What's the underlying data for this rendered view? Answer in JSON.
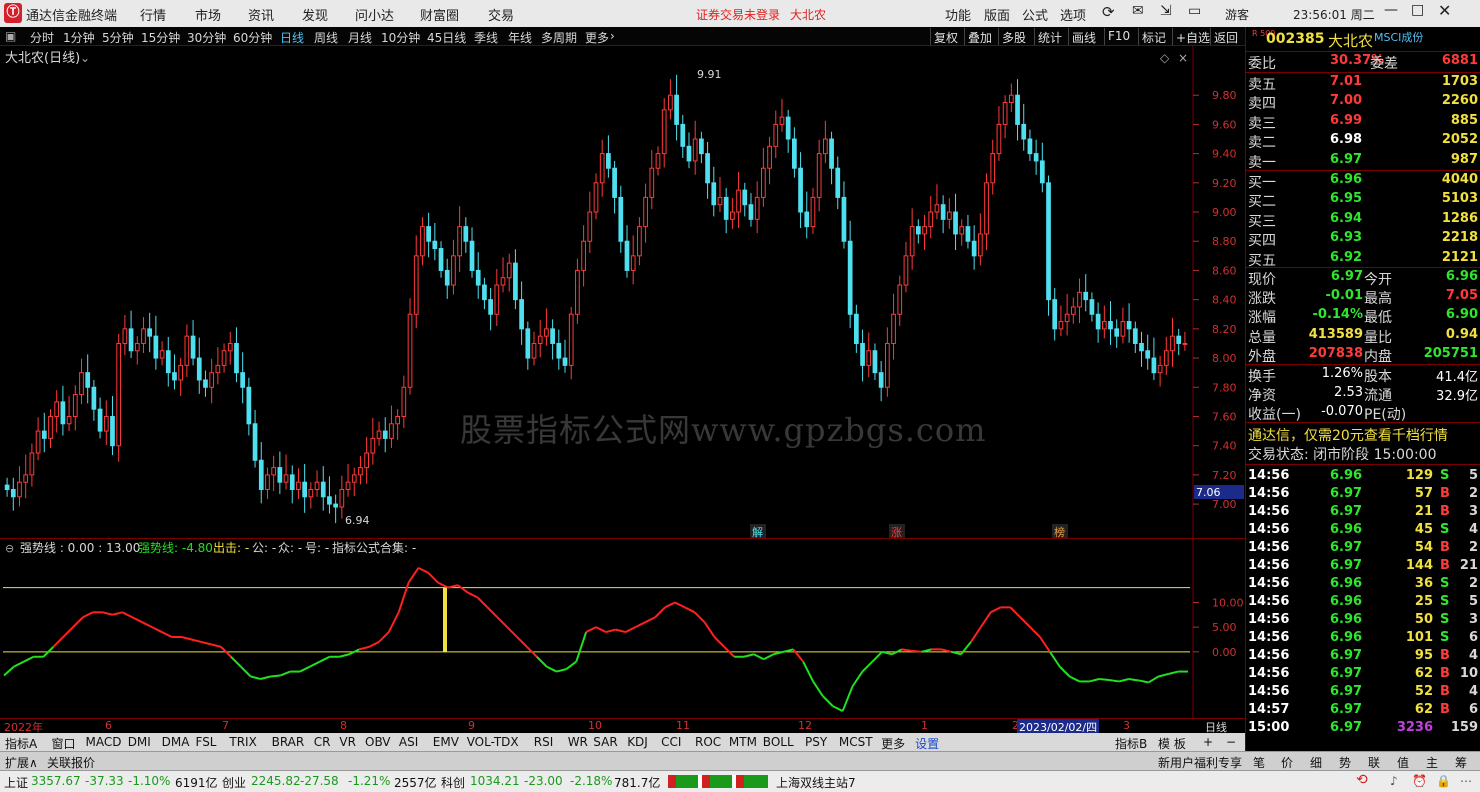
{
  "titlebar": {
    "app_name": "通达信金融终端",
    "menus": [
      "行情",
      "市场",
      "资讯",
      "发现",
      "问小达",
      "财富圈",
      "交易"
    ],
    "notice": "证券交易未登录",
    "stock_name": "大北农",
    "right_menus": [
      "功能",
      "版面",
      "公式",
      "选项"
    ],
    "user": "游客",
    "clock": "23:56:01 周二"
  },
  "periods": [
    "分时",
    "1分钟",
    "5分钟",
    "15分钟",
    "30分钟",
    "60分钟",
    "日线",
    "周线",
    "月线",
    "10分钟",
    "45日线",
    "季线",
    "年线",
    "多周期",
    "更多"
  ],
  "active_period": "日线",
  "chart_tools": [
    "复权",
    "叠加",
    "多股",
    "统计",
    "画线",
    "F10",
    "标记",
    "+自选",
    "返回"
  ],
  "chart_title": "大北农(日线)",
  "price_axis": [
    "9.80",
    "9.60",
    "9.40",
    "9.20",
    "9.00",
    "8.80",
    "8.60",
    "8.40",
    "8.20",
    "8.00",
    "7.80",
    "7.60",
    "7.40",
    "7.20",
    "7.00"
  ],
  "current_price_tag": "7.06",
  "chart_annotations": {
    "high": "9.91",
    "low": "6.94"
  },
  "event_marks": [
    "解",
    "涨",
    "榜"
  ],
  "indicator_header": {
    "name": "强势线 : 0.00 : 13.00",
    "line": "强势线: -4.80",
    "out": "出击: -",
    "gong": "公: -",
    "zhong": "众: -",
    "hao": "号: -",
    "collection": "指标公式合集: -"
  },
  "indicator_axis": [
    "10.00",
    "5.00",
    "0.00"
  ],
  "watermark": "股票指标公式网www.gpzbgs.com",
  "date_axis": {
    "labels": [
      "2022年",
      "6",
      "7",
      "8",
      "9",
      "10",
      "11",
      "12",
      "1",
      "2",
      "3"
    ],
    "cursor_date": "2023/02/02/四",
    "period_label": "日线"
  },
  "indicator_tabs": [
    "指标A",
    "窗口",
    "MACD",
    "DMI",
    "DMA",
    "FSL",
    "TRIX",
    "BRAR",
    "CR",
    "VR",
    "OBV",
    "ASI",
    "EMV",
    "VOL-TDX",
    "RSI",
    "WR",
    "SAR",
    "KDJ",
    "CCI",
    "ROC",
    "MTM",
    "BOLL",
    "PSY",
    "MCST",
    "更多",
    "设置"
  ],
  "indicator_tabs_right": [
    "指标B",
    "模 板",
    "+",
    "−"
  ],
  "ext_tabs": [
    "扩展∧",
    "关联报价"
  ],
  "ext_right": {
    "promo": "新用户福利专享",
    "tabs": [
      "笔",
      "价",
      "细",
      "势",
      "联",
      "值",
      "主",
      "筹"
    ]
  },
  "status": {
    "sh_label": "上证",
    "sh_value": "3357.67",
    "sh_change": "-37.33",
    "sh_pct": "-1.10%",
    "sh_amount": "6191亿",
    "cy_label": "创业",
    "cy_value": "2245.82",
    "cy_change": "-27.58",
    "cy_pct": "-1.21%",
    "cy_amount": "2557亿",
    "kc_label": "科创",
    "kc_value": "1034.21",
    "kc_change": "-23.00",
    "kc_pct": "-2.18%",
    "kc_amount": "781.7亿",
    "server": "上海双线主站7"
  },
  "quote": {
    "badge": "R 500",
    "code": "002385",
    "name": "大北农",
    "tag": "MSCI成份",
    "wb_label": "委比",
    "wb_value": "30.37%",
    "wc_label": "委差",
    "wc_value": "6881",
    "asks": [
      {
        "label": "卖五",
        "price": "7.01",
        "vol": "1703",
        "color": "#ff3a3a"
      },
      {
        "label": "卖四",
        "price": "7.00",
        "vol": "2260",
        "color": "#ff3a3a"
      },
      {
        "label": "卖三",
        "price": "6.99",
        "vol": "885",
        "color": "#ff3a3a"
      },
      {
        "label": "卖二",
        "price": "6.98",
        "vol": "2052",
        "color": "#ffffff"
      },
      {
        "label": "卖一",
        "price": "6.97",
        "vol": "987",
        "color": "#2ee62e"
      }
    ],
    "bids": [
      {
        "label": "买一",
        "price": "6.96",
        "vol": "4040",
        "color": "#2ee62e"
      },
      {
        "label": "买二",
        "price": "6.95",
        "vol": "5103",
        "color": "#2ee62e"
      },
      {
        "label": "买三",
        "price": "6.94",
        "vol": "1286",
        "color": "#2ee62e"
      },
      {
        "label": "买四",
        "price": "6.93",
        "vol": "2218",
        "color": "#2ee62e"
      },
      {
        "label": "买五",
        "price": "6.92",
        "vol": "2121",
        "color": "#2ee62e"
      }
    ],
    "stats": [
      {
        "l1": "现价",
        "v1": "6.97",
        "c1": "#2ee62e",
        "l2": "今开",
        "v2": "6.96",
        "c2": "#2ee62e"
      },
      {
        "l1": "涨跌",
        "v1": "-0.01",
        "c1": "#2ee62e",
        "l2": "最高",
        "v2": "7.05",
        "c2": "#ff3a3a"
      },
      {
        "l1": "涨幅",
        "v1": "-0.14%",
        "c1": "#2ee62e",
        "l2": "最低",
        "v2": "6.90",
        "c2": "#2ee62e"
      },
      {
        "l1": "总量",
        "v1": "413589",
        "c1": "#f0e040",
        "l2": "量比",
        "v2": "0.94",
        "c2": "#f0e040"
      },
      {
        "l1": "外盘",
        "v1": "207838",
        "c1": "#ff3a3a",
        "l2": "内盘",
        "v2": "205751",
        "c2": "#2ee62e"
      }
    ],
    "stats2": [
      {
        "l1": "换手",
        "v1": "1.26%",
        "l2": "股本",
        "v2": "41.4亿"
      },
      {
        "l1": "净资",
        "v1": "2.53",
        "l2": "流通",
        "v2": "32.9亿"
      },
      {
        "l1": "收益(一)",
        "v1": "-0.070",
        "l2": "PE(动)",
        "v2": ""
      }
    ],
    "promo": "通达信，仅需20元查看千档行情",
    "trade_state": "交易状态: 闭市阶段 15:00:00",
    "ticks": [
      {
        "t": "14:56",
        "p": "6.96",
        "pc": "#2ee62e",
        "v": "129",
        "d": "S",
        "n": "5"
      },
      {
        "t": "14:56",
        "p": "6.97",
        "pc": "#2ee62e",
        "v": "57",
        "d": "B",
        "n": "2"
      },
      {
        "t": "14:56",
        "p": "6.97",
        "pc": "#2ee62e",
        "v": "21",
        "d": "B",
        "n": "3"
      },
      {
        "t": "14:56",
        "p": "6.96",
        "pc": "#2ee62e",
        "v": "45",
        "d": "S",
        "n": "4"
      },
      {
        "t": "14:56",
        "p": "6.97",
        "pc": "#2ee62e",
        "v": "54",
        "d": "B",
        "n": "2"
      },
      {
        "t": "14:56",
        "p": "6.97",
        "pc": "#2ee62e",
        "v": "144",
        "d": "B",
        "n": "21"
      },
      {
        "t": "14:56",
        "p": "6.96",
        "pc": "#2ee62e",
        "v": "36",
        "d": "S",
        "n": "2"
      },
      {
        "t": "14:56",
        "p": "6.96",
        "pc": "#2ee62e",
        "v": "25",
        "d": "S",
        "n": "5"
      },
      {
        "t": "14:56",
        "p": "6.96",
        "pc": "#2ee62e",
        "v": "50",
        "d": "S",
        "n": "3"
      },
      {
        "t": "14:56",
        "p": "6.96",
        "pc": "#2ee62e",
        "v": "101",
        "d": "S",
        "n": "6"
      },
      {
        "t": "14:56",
        "p": "6.97",
        "pc": "#2ee62e",
        "v": "95",
        "d": "B",
        "n": "4"
      },
      {
        "t": "14:56",
        "p": "6.97",
        "pc": "#2ee62e",
        "v": "62",
        "d": "B",
        "n": "10"
      },
      {
        "t": "14:56",
        "p": "6.97",
        "pc": "#2ee62e",
        "v": "52",
        "d": "B",
        "n": "4"
      },
      {
        "t": "14:57",
        "p": "6.97",
        "pc": "#2ee62e",
        "v": "62",
        "d": "B",
        "n": "6"
      },
      {
        "t": "15:00",
        "p": "6.97",
        "pc": "#2ee62e",
        "v": "3236",
        "d": "",
        "n": "159"
      }
    ]
  },
  "colors": {
    "up": "#ff3a3a",
    "down": "#4fe0f0",
    "red_line": "#ff2020",
    "green_line": "#20e020",
    "yellow": "#f0e040",
    "bg": "#000000"
  },
  "chart_data": {
    "type": "candlestick",
    "ylim": [
      6.85,
      10.0
    ],
    "closes": [
      7.1,
      7.05,
      7.15,
      7.2,
      7.35,
      7.5,
      7.45,
      7.6,
      7.7,
      7.55,
      7.6,
      7.75,
      7.9,
      7.8,
      7.65,
      7.5,
      7.6,
      7.4,
      8.1,
      8.2,
      8.05,
      8.1,
      8.2,
      8.15,
      8.0,
      8.05,
      7.9,
      7.85,
      7.95,
      8.15,
      8.0,
      7.85,
      7.8,
      7.9,
      7.95,
      8.05,
      8.1,
      7.9,
      7.8,
      7.55,
      7.3,
      7.1,
      7.2,
      7.25,
      7.15,
      7.2,
      7.1,
      7.15,
      7.05,
      7.1,
      7.15,
      7.05,
      7.0,
      6.98,
      7.1,
      7.15,
      7.2,
      7.25,
      7.35,
      7.45,
      7.5,
      7.45,
      7.55,
      7.6,
      7.8,
      8.3,
      8.7,
      8.9,
      8.8,
      8.75,
      8.6,
      8.5,
      8.7,
      8.9,
      8.8,
      8.6,
      8.5,
      8.4,
      8.3,
      8.5,
      8.55,
      8.65,
      8.4,
      8.2,
      8.0,
      8.1,
      8.15,
      8.2,
      8.1,
      8.0,
      7.95,
      8.3,
      8.6,
      8.8,
      9.0,
      9.2,
      9.4,
      9.3,
      9.1,
      8.8,
      8.6,
      8.7,
      8.9,
      9.1,
      9.3,
      9.4,
      9.7,
      9.8,
      9.6,
      9.45,
      9.35,
      9.5,
      9.4,
      9.2,
      9.05,
      9.1,
      8.95,
      9.0,
      9.15,
      9.05,
      8.95,
      9.1,
      9.3,
      9.45,
      9.6,
      9.65,
      9.5,
      9.3,
      9.0,
      8.9,
      9.1,
      9.4,
      9.5,
      9.3,
      9.1,
      8.8,
      8.3,
      8.1,
      7.95,
      8.05,
      7.9,
      7.8,
      8.1,
      8.3,
      8.5,
      8.7,
      8.9,
      8.85,
      8.9,
      9.0,
      9.05,
      8.95,
      9.0,
      8.85,
      8.9,
      8.8,
      8.7,
      8.85,
      9.2,
      9.4,
      9.6,
      9.75,
      9.8,
      9.6,
      9.5,
      9.4,
      9.35,
      9.2,
      8.4,
      8.2,
      8.25,
      8.3,
      8.35,
      8.45,
      8.4,
      8.3,
      8.2,
      8.25,
      8.2,
      8.15,
      8.25,
      8.2,
      8.1,
      8.05,
      8.0,
      7.9,
      7.95,
      8.05,
      8.15,
      8.1,
      8.1
    ],
    "indicator": {
      "values": [
        -4.8,
        -3,
        -2,
        -1,
        -1,
        1,
        3,
        5,
        7,
        8,
        8,
        7.5,
        8,
        7,
        6,
        5,
        4,
        3,
        3,
        2.5,
        2,
        1.5,
        1,
        -1,
        -3,
        -5,
        -5.5,
        -5,
        -4.8,
        -4,
        -4,
        -3,
        -2,
        -1,
        -1,
        -0.5,
        0.5,
        1,
        2,
        4,
        8,
        14,
        17,
        16,
        14,
        13,
        13.5,
        12,
        11,
        9,
        7,
        5,
        3,
        1,
        -1,
        -3,
        -4,
        -3.5,
        -2,
        4,
        5,
        4,
        4.5,
        4,
        5,
        6,
        7,
        9,
        10,
        9,
        8,
        6,
        3,
        1,
        -1,
        -1,
        -0.5,
        -1.5,
        -0.5,
        0,
        0.5,
        -2,
        -6,
        -9,
        -11,
        -12,
        -7,
        -4,
        -2,
        0,
        -0.5,
        0.5,
        0.2,
        0,
        0.5,
        0.5,
        0,
        -0.5,
        2,
        5,
        8,
        9,
        9,
        7,
        5,
        3,
        0,
        -3,
        -5,
        -6,
        -6,
        -5.5,
        -5.7,
        -6,
        -5.5,
        -5.8,
        -6.2,
        -5,
        -4.5,
        -4,
        -4
      ],
      "ylim": [
        -13,
        19
      ],
      "ref_lines": [
        0,
        13
      ]
    }
  }
}
